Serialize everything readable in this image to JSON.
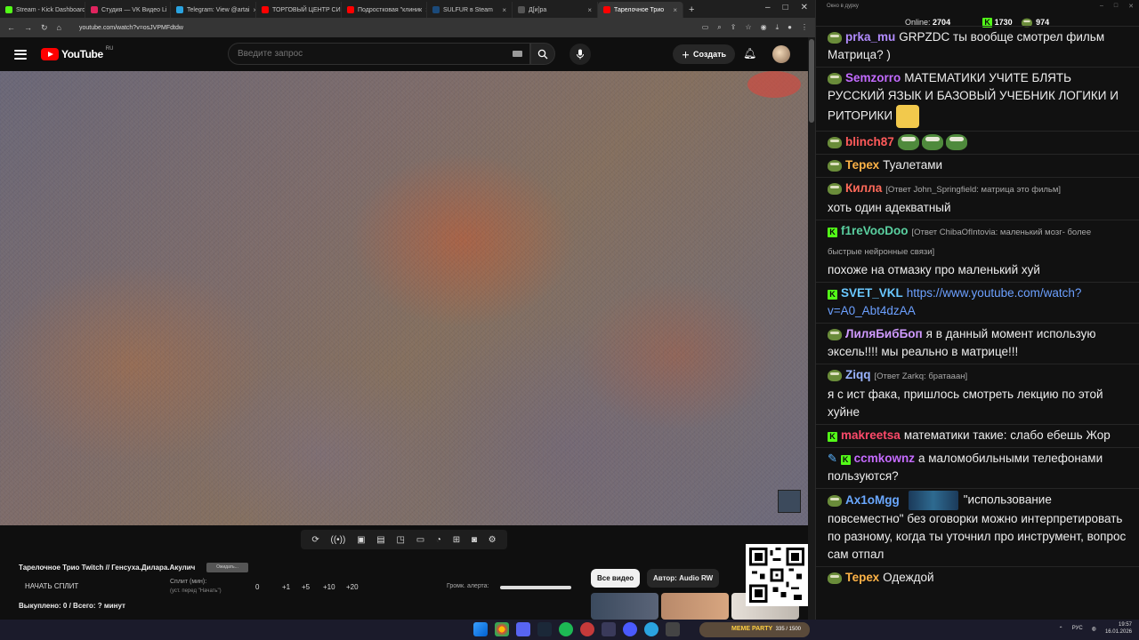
{
  "browser": {
    "tabs": [
      {
        "title": "Stream - Kick Dashboard",
        "color": "#53fc18"
      },
      {
        "title": "Студия — VK Видео Li",
        "color": "#e0245e"
      },
      {
        "title": "Telegram: View @artai",
        "color": "#2aa3e0"
      },
      {
        "title": "ТОРГОВЫЙ ЦЕНТР СИ",
        "color": "#ff0000"
      },
      {
        "title": "Подростковая \"клиник",
        "color": "#ff0000"
      },
      {
        "title": "SULFUR в Steam",
        "color": "#1b4a7a"
      },
      {
        "title": "Д[и]ра",
        "color": "#555555"
      },
      {
        "title": "Тарелочное Трио",
        "color": "#ff0000",
        "active": true
      }
    ],
    "url": "youtube.com/watch?v=osJVPMFdtdw"
  },
  "youtube": {
    "logo_text": "YouTube",
    "logo_region": "RU",
    "search_placeholder": "Введите запрос",
    "create_label": "Создать",
    "icons": {
      "menu": "hamburger-icon",
      "search": "search-icon",
      "mic": "mic-icon",
      "bell": "bell-icon"
    }
  },
  "controls": {
    "icons": [
      "repeat-icon",
      "broadcast-icon",
      "video-settings-icon",
      "clapperboard-icon",
      "picture-in-picture-icon",
      "screen-icon",
      "speed-icon",
      "add-clip-icon",
      "camera-icon",
      "gear-icon"
    ]
  },
  "panel": {
    "title": "Тарелочное Трио Twitch // Генсуха.Дилара.Акулич",
    "tag": "Ожидать...",
    "split_button": "НАЧАТЬ СПЛИТ",
    "split_label": "Сплит (мин):",
    "split_sub": "(уст. перед \"Начать\")",
    "split_value": "0",
    "steps": [
      "+1",
      "+5",
      "+10",
      "+20"
    ],
    "alert_label": "Громк. алерта:",
    "alert_level": 1.0,
    "sold": "Выкуплено: 0 / Всего: ? минут",
    "chip_all": "Все видео",
    "chip_author": "Автор: Audio RW"
  },
  "chat": {
    "window_title": "Окно в дурку",
    "online_label": "Online:",
    "online_value": "2704",
    "kick_count": "1730",
    "other_count": "974",
    "messages": [
      {
        "badge": "pepe",
        "nick": "prka_mu",
        "nick_color": "#b28cff",
        "text": "GRPZDC ты вообще смотрел фильм Матрица? )"
      },
      {
        "badge": "pepe",
        "nick": "Semzorro",
        "nick_color": "#c36bff",
        "text": "МАТЕМАТИКИ УЧИТЕ БЛЯТЬ РУССКИЙ ЯЗЫК И БАЗОВЫЙ УЧЕБНИК ЛОГИКИ И РИТОРИКИ",
        "emote": "face"
      },
      {
        "badge": "pepe",
        "nick": "blinch87",
        "nick_color": "#ff5a5a",
        "text": "",
        "emote": "frogs"
      },
      {
        "badge": "pepe",
        "nick": "Терех",
        "nick_color": "#ffb347",
        "text": "Туалетами"
      },
      {
        "badge": "pepe",
        "nick": "Килла",
        "nick_color": "#ff6a5a",
        "reply": "[Ответ John_Springfield: матрица это фильм]",
        "text": "хоть один адекватный"
      },
      {
        "badge": "kick",
        "nick": "f1reVooDoo",
        "nick_color": "#5ad0a0",
        "reply": "[Ответ ChibaOfIntovia: маленький мозг- более быстрые нейронные связи]",
        "text": "похоже на отмазку про маленький хуй"
      },
      {
        "badge": "kick",
        "nick": "SVET_VKL",
        "nick_color": "#6ac8ff",
        "link": "https://www.youtube.com/watch?v=A0_Abt4dzAA",
        "text": ""
      },
      {
        "badge": "pepe",
        "nick": "ЛиляБибБоп",
        "nick_color": "#d09aff",
        "text": "я в данный момент использую эксель!!!! мы реально в матрице!!!"
      },
      {
        "badge": "pepe",
        "nick": "Ziqq",
        "nick_color": "#9ab4ff",
        "reply": "[Ответ Zarkq: братааан]",
        "text": "я с ист фака, пришлось смотреть лекцию по этой хуйне"
      },
      {
        "badge": "kick",
        "nick": "makreetsa",
        "nick_color": "#ff4a6a",
        "text": "математики такие: слабо ебешь Жор"
      },
      {
        "badge": "kick",
        "nick": "ccmkownz",
        "nick_color": "#c56bff",
        "pin": true,
        "text": "а маломобильными телефонами пользуются?"
      },
      {
        "badge": "pepe",
        "nick": "Ax1oMgg",
        "nick_color": "#6aa8ff",
        "emote": "blue",
        "text": "\"использование повсеместно\" без оговорки можно интерпретировать по разному, когда ты уточнил про инструмент, вопрос сам отпал"
      },
      {
        "badge": "pepe",
        "nick": "Терех",
        "nick_color": "#ffb347",
        "text": "Одеждой"
      }
    ]
  },
  "taskbar": {
    "media_title": "MEME PARTY",
    "media_count": "335 / 1500",
    "lang": "РУС",
    "time": "19:57",
    "date": "16.01.2026"
  }
}
